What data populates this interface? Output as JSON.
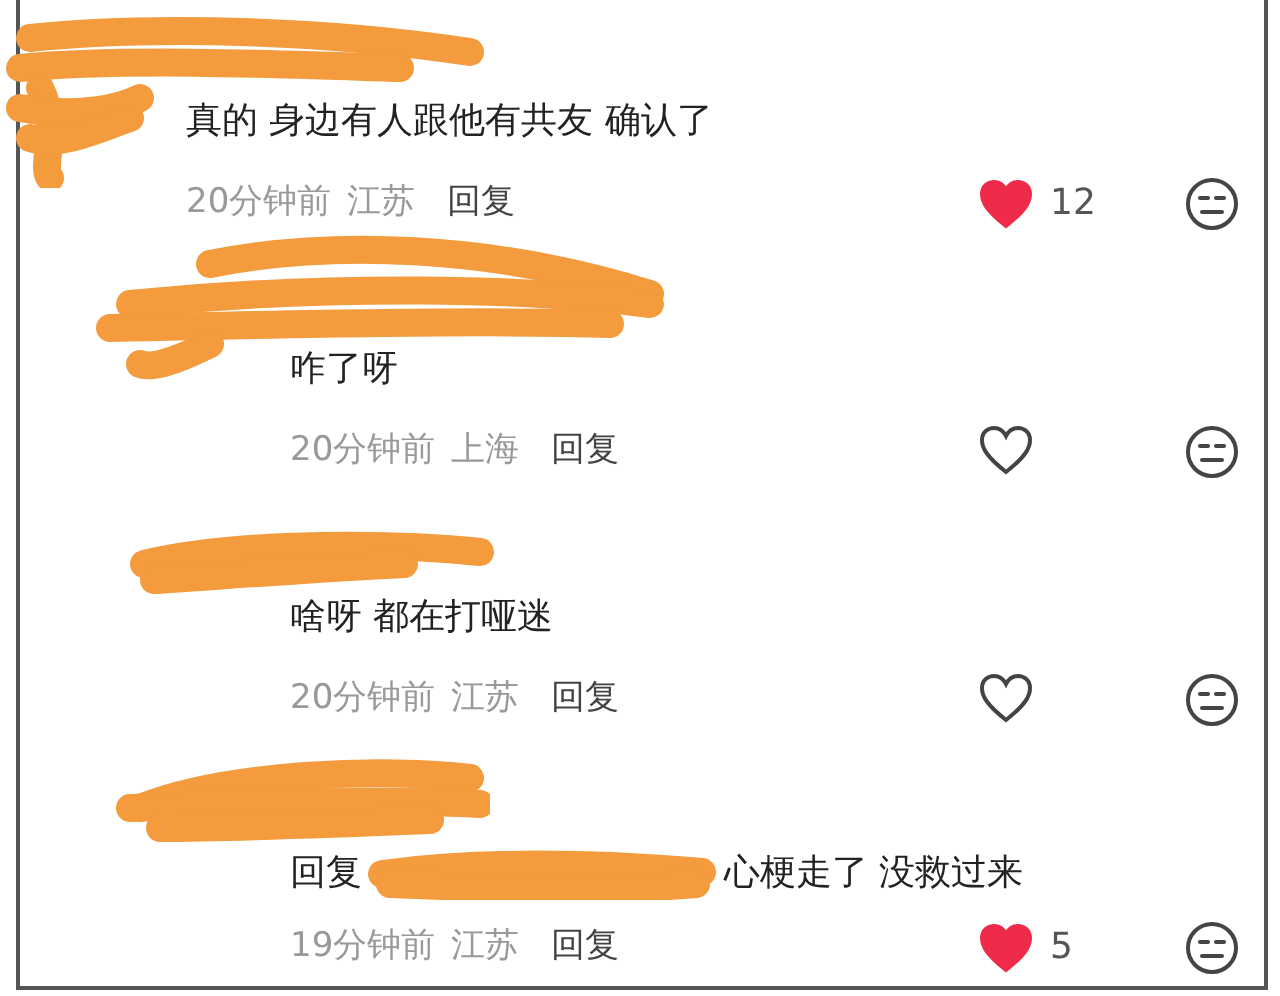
{
  "comments": [
    {
      "kind": "comment",
      "text": "真的 身边有人跟他有共友 确认了",
      "time": "20分钟前",
      "location": "江苏",
      "reply_label": "回复",
      "liked": true,
      "like_count": "12"
    },
    {
      "kind": "reply",
      "text": "咋了呀",
      "time": "20分钟前",
      "location": "上海",
      "reply_label": "回复",
      "liked": false
    },
    {
      "kind": "reply",
      "text": "啥呀 都在打哑迷",
      "time": "20分钟前",
      "location": "江苏",
      "reply_label": "回复",
      "liked": false
    },
    {
      "kind": "reply",
      "reply_prefix": "回复",
      "text": "心梗走了 没救过来",
      "time": "19分钟前",
      "location": "江苏",
      "reply_label": "回复",
      "liked": true,
      "like_count": "5"
    }
  ]
}
